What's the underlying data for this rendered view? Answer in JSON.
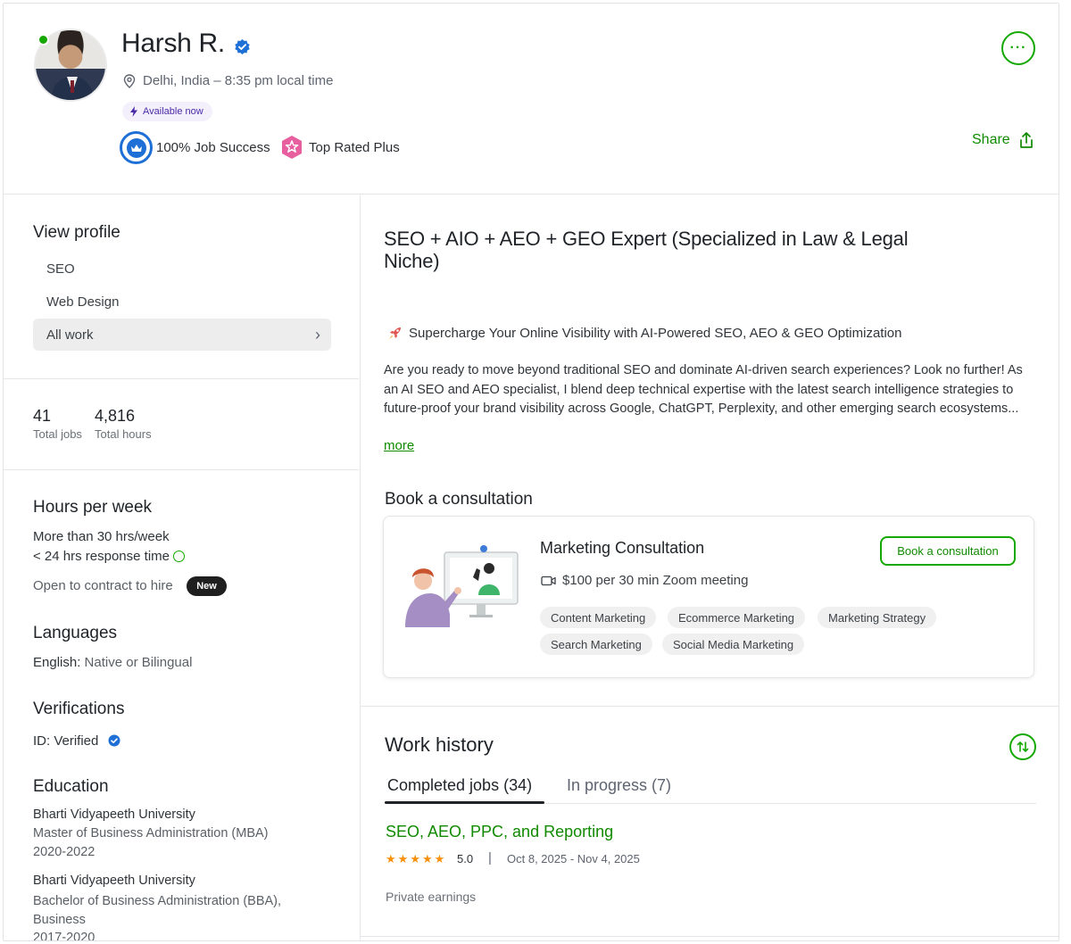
{
  "profile": {
    "name": "Harsh R.",
    "location": "Delhi, India – 8:35 pm local time",
    "availability": "Available now",
    "job_success": "100% Job Success",
    "top_rated": "Top Rated Plus",
    "share_label": "Share",
    "more_label": "···"
  },
  "sidebar": {
    "view_profile_title": "View profile",
    "nav": [
      {
        "label": "SEO"
      },
      {
        "label": "Web Design"
      },
      {
        "label": "All work",
        "chevron": "›"
      }
    ],
    "stats": [
      {
        "value": "41",
        "label": "Total jobs"
      },
      {
        "value": "4,816",
        "label": "Total hours"
      }
    ],
    "hours_title": "Hours per week",
    "hours_value": "More than 30 hrs/week",
    "response_time": "< 24 hrs response time",
    "contract_to_hire": "Open to contract to hire",
    "now_badge": "New",
    "languages_title": "Languages",
    "language_name": "English:",
    "language_level": "Native or Bilingual",
    "verifications_title": "Verifications",
    "id_verified": "ID: Verified",
    "education_title": "Education",
    "education": [
      {
        "school": "Bharti Vidyapeeth University",
        "degree": "Master of Business Administration (MBA)",
        "years": "2020-2022"
      },
      {
        "school": "Bharti Vidyapeeth University",
        "degree": "Bachelor of Business Administration (BBA), Business",
        "years": "2017-2020"
      }
    ]
  },
  "main": {
    "headline": "SEO + AIO + AEO + GEO Expert (Specialized in Law & Legal Niche)",
    "tagline": "Supercharge Your Online Visibility with AI-Powered SEO, AEO & GEO Optimization",
    "description": "Are you ready to move beyond traditional SEO and dominate AI-driven search experiences? Look no further! As an AI SEO and AEO specialist, I blend deep technical expertise with the latest search intelligence strategies to future-proof your brand visibility across Google, ChatGPT, Perplexity, and other emerging search ecosystems...",
    "more_link": "more",
    "book_title": "Book a consultation",
    "consultation": {
      "title": "Marketing Consultation",
      "price": "$100 per 30 min Zoom meeting",
      "button": "Book a consultation",
      "tags": [
        "Content Marketing",
        "Ecommerce Marketing",
        "Marketing Strategy",
        "Search Marketing",
        "Social Media Marketing"
      ]
    },
    "work_history": {
      "title": "Work history",
      "tabs": [
        {
          "label": "Completed jobs (34)",
          "active": true
        },
        {
          "label": "In progress (7)",
          "active": false
        }
      ],
      "job": {
        "title": "SEO, AEO, PPC, and Reporting",
        "rating": "5.0",
        "stars": 5,
        "separator": "|",
        "dates": "Oct 8, 2025 - Nov 4, 2025",
        "earnings": "Private earnings"
      }
    }
  },
  "colors": {
    "brand_green": "#14a800",
    "link_green": "#108a00",
    "verified_blue": "#1e6fd6",
    "star_orange": "#f79009",
    "top_rated_pink": "#e85fa0"
  }
}
